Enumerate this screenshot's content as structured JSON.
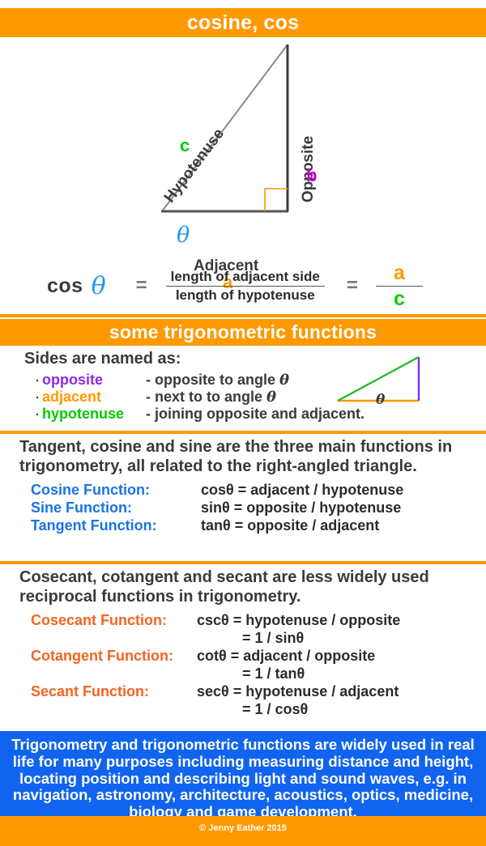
{
  "header": {
    "main_title": "cosine, cos",
    "sub_title": "some trigonometric functions"
  },
  "diagram": {
    "hypotenuse_label": "Hypotenuse",
    "hypotenuse_var": "c",
    "opposite_label": "Opposite",
    "opposite_var": "b",
    "adjacent_label": "Adjacent",
    "adjacent_var": "a",
    "angle_symbol": "θ",
    "colors": {
      "hypotenuse": "#00CC00",
      "opposite": "#CC00CC",
      "adjacent": "#FF9900",
      "angle": "#2196F3",
      "right_angle_marker": "#FF9900",
      "triangle_stroke": "#808080",
      "leg_stroke": "#555555"
    }
  },
  "formula": {
    "function_name": "cos",
    "angle_symbol": "θ",
    "equals": "=",
    "numerator": "length of adjacent side",
    "denominator": "length of hypotenuse",
    "equals_2": "=",
    "ratio_numerator": "a",
    "ratio_denominator": "c"
  },
  "sides": {
    "heading": "Sides are named as:",
    "bullet": "·",
    "items": [
      {
        "term": "opposite",
        "description": "- opposite to angle ",
        "angle": "θ",
        "color": "#8A2BE2"
      },
      {
        "term": "adjacent",
        "description": "- next to to angle ",
        "angle": "θ",
        "color": "#FF9900"
      },
      {
        "term": "hypotenuse",
        "description": "- joining opposite and adjacent.",
        "angle": "",
        "color": "#00CC00"
      }
    ],
    "mini_triangle_angle": "θ"
  },
  "main_functions": {
    "paragraph": "Tangent, cosine and sine are the three main functions in trigonometry, all related to the right-angled triangle.",
    "rows": [
      {
        "name": "Cosine Function:",
        "formula": "cosθ = adjacent / hypotenuse",
        "formula2": ""
      },
      {
        "name": "Sine Function:",
        "formula": "sinθ  = opposite / hypotenuse",
        "formula2": ""
      },
      {
        "name": "Tangent Function:",
        "formula": "tanθ  = opposite / adjacent",
        "formula2": ""
      }
    ],
    "label_color": "#1a73e8"
  },
  "reciprocal_functions": {
    "paragraph": "Cosecant, cotangent and secant are less widely used reciprocal functions in trigonometry.",
    "rows": [
      {
        "name": "Cosecant Function:",
        "formula": "cscθ = hypotenuse / opposite",
        "formula2": "= 1 / sinθ"
      },
      {
        "name": "Cotangent Function:",
        "formula": "cotθ = adjacent / opposite",
        "formula2": "= 1 / tanθ"
      },
      {
        "name": "Secant Function:",
        "formula": "secθ = hypotenuse / adjacent",
        "formula2": "= 1 / cosθ"
      }
    ],
    "label_color": "#F26522"
  },
  "usage_note": {
    "text": "Trigonometry and trigonometric functions are widely used in real life for many purposes including measuring distance and height, locating position and describing light and sound waves, e.g. in navigation, astronomy, architecture, acoustics, optics, medicine, biology and game development.",
    "background": "#1064ef"
  },
  "footer": {
    "credit": "© Jenny Eather 2015",
    "background": "#FF9900"
  }
}
